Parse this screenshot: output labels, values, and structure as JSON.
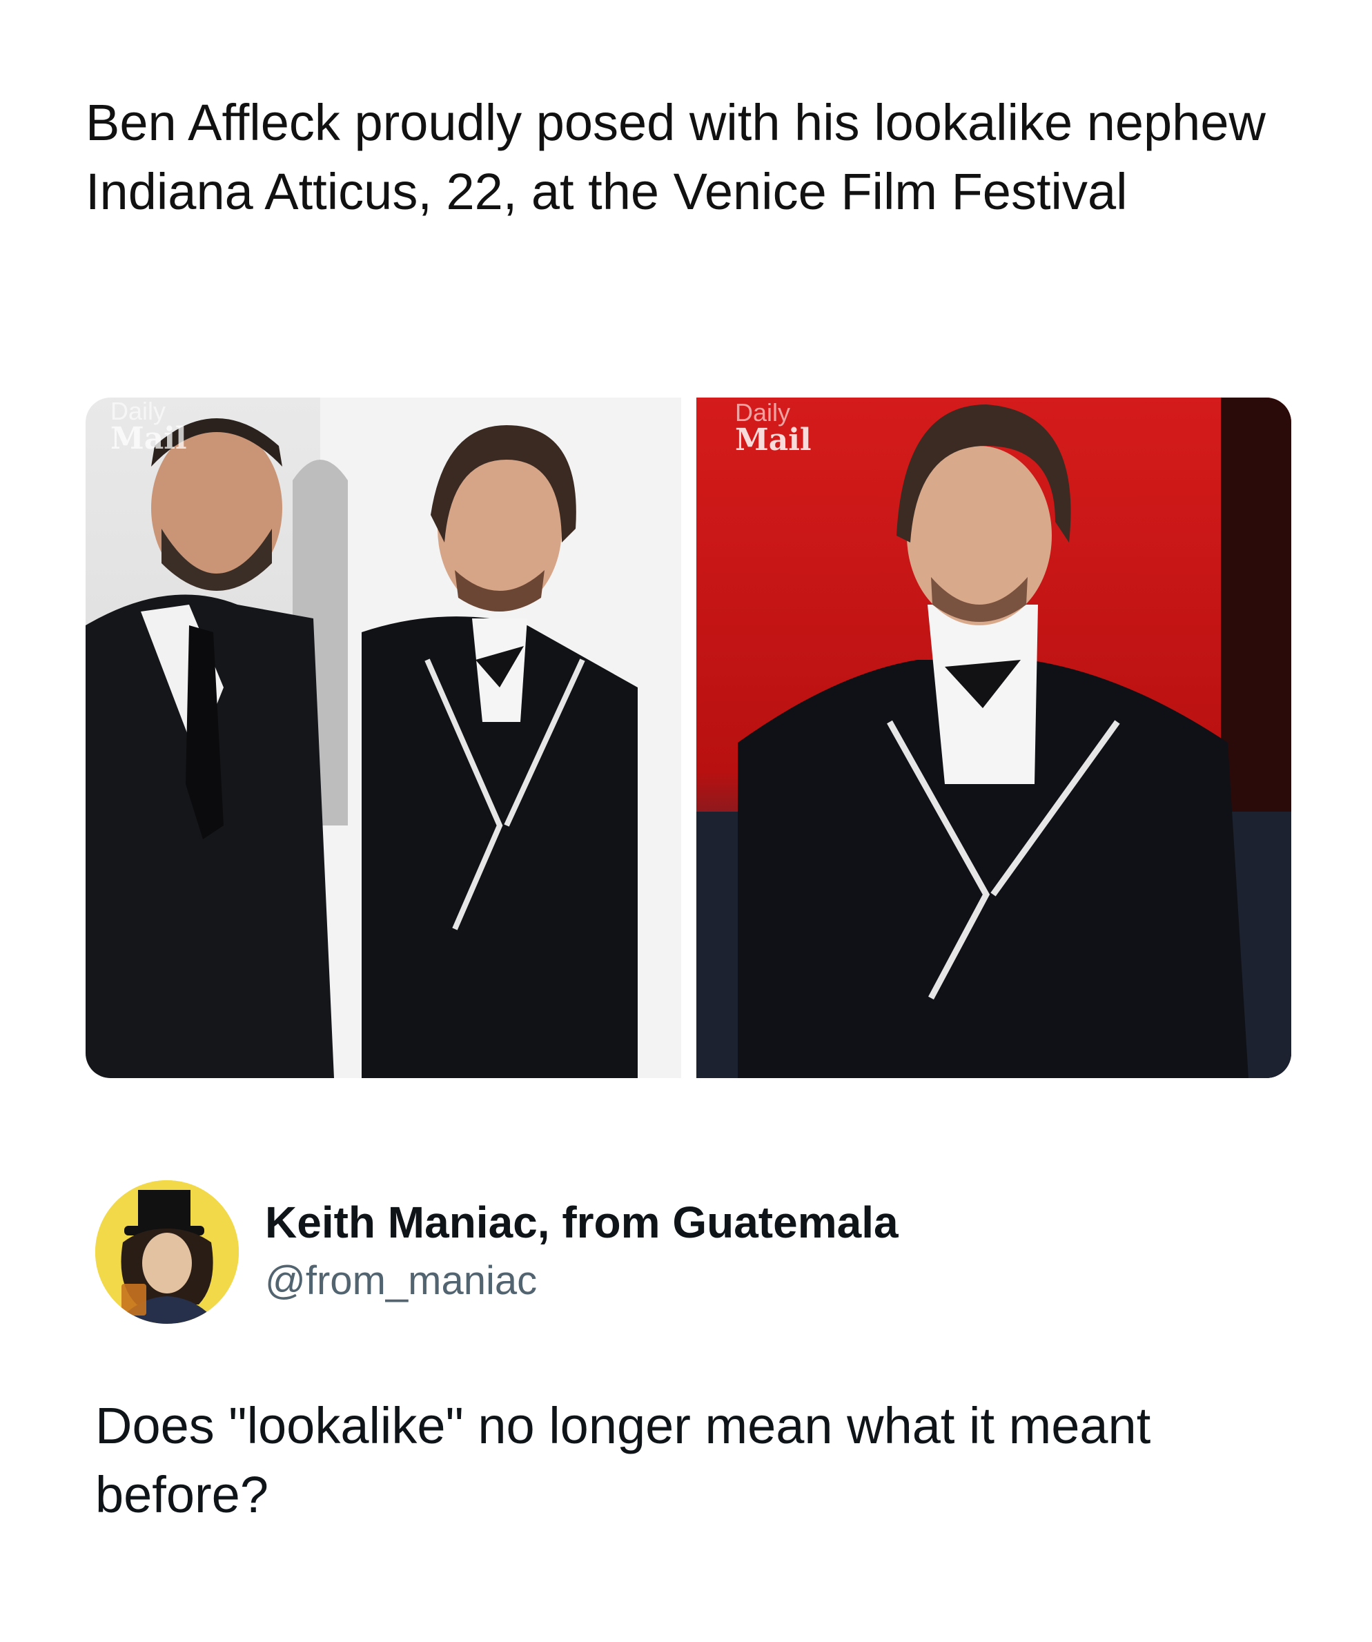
{
  "headline": "Ben Affleck proudly posed with his lookalike nephew Indiana Atticus, 22, at the Venice Film Festival",
  "photos": {
    "left": {
      "watermark_top": "Daily",
      "watermark_bottom": "Mail"
    },
    "right": {
      "watermark_top": "Daily",
      "watermark_bottom": "Mail"
    }
  },
  "author": {
    "display_name": "Keith Maniac, from Guatemala",
    "handle": "@from_maniac"
  },
  "tweet": {
    "text": "Does \"lookalike\" no longer mean what it meant before?"
  },
  "colors": {
    "text_primary": "#0f1419",
    "text_secondary": "#536471",
    "right_photo_bg": "#d51b1b",
    "avatar_bg": "#f1d94a"
  }
}
